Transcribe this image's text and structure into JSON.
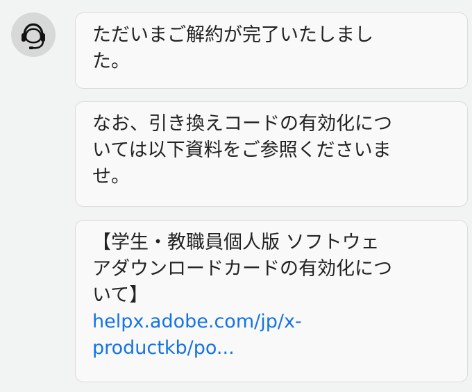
{
  "agent": {
    "avatar_icon": "headset-icon"
  },
  "messages": [
    {
      "lines": [
        "ただいまご解約が完了いたしまし",
        "た。"
      ]
    },
    {
      "lines": [
        "なお、引き換えコードの有効化につ",
        "いては以下資料をご参照くださいま",
        "せ。"
      ]
    },
    {
      "lines": [
        "【学生・教職員個人版 ソフトウェ",
        "アダウンロードカードの有効化につ",
        "いて】"
      ],
      "link_lines": [
        "helpx.adobe.com/jp/x-",
        "productkb/po..."
      ]
    }
  ],
  "colors": {
    "link": "#1473e6",
    "bubble_bg": "#f9f9f9",
    "page_bg": "#f2f3f3"
  }
}
